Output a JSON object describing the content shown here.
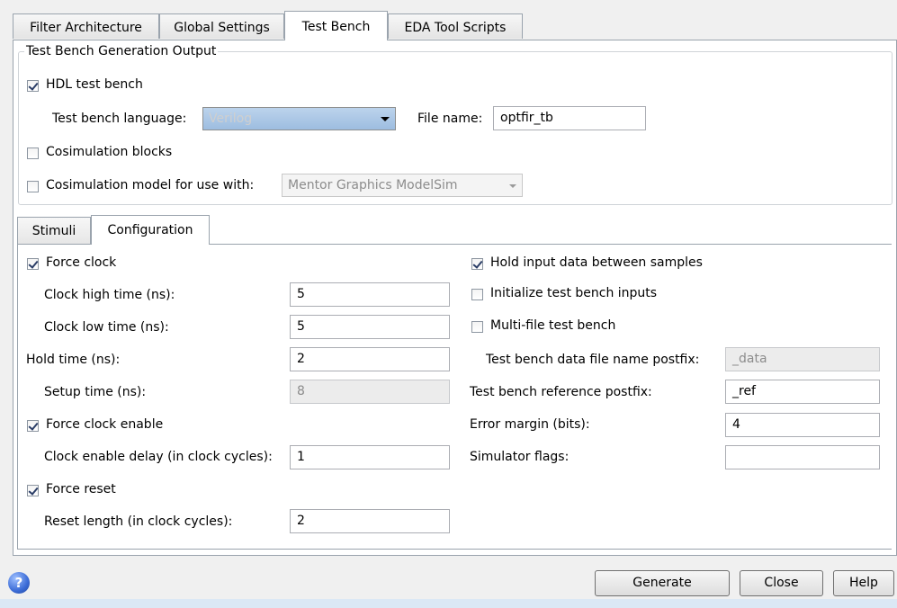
{
  "tabs": [
    "Filter Architecture",
    "Global Settings",
    "Test Bench",
    "EDA Tool Scripts"
  ],
  "output_group": {
    "title": "Test Bench Generation Output",
    "hdl_test_bench": {
      "label": "HDL test bench",
      "checked": true
    },
    "language_label": "Test bench language:",
    "language_value": "Verilog",
    "file_name_label": "File name:",
    "file_name_value": "optfir_tb",
    "cosim_blocks": {
      "label": "Cosimulation blocks",
      "checked": false
    },
    "cosim_model": {
      "label": "Cosimulation model for use with:",
      "checked": false
    },
    "cosim_tool_value": "Mentor Graphics ModelSim"
  },
  "inner_tabs": [
    "Stimuli",
    "Configuration"
  ],
  "config": {
    "force_clock": {
      "label": "Force clock",
      "checked": true
    },
    "clock_high_label": "Clock high time (ns):",
    "clock_high_value": "5",
    "clock_low_label": "Clock low time (ns):",
    "clock_low_value": "5",
    "hold_time_label": "Hold time (ns):",
    "hold_time_value": "2",
    "setup_time_label": "Setup time (ns):",
    "setup_time_value": "8",
    "force_clock_enable": {
      "label": "Force clock enable",
      "checked": true
    },
    "clock_enable_delay_label": "Clock enable delay (in clock cycles):",
    "clock_enable_delay_value": "1",
    "force_reset": {
      "label": "Force reset",
      "checked": true
    },
    "reset_length_label": "Reset length (in clock cycles):",
    "reset_length_value": "2",
    "hold_input": {
      "label": "Hold input data between samples",
      "checked": true
    },
    "init_inputs": {
      "label": "Initialize test bench inputs",
      "checked": false
    },
    "multi_file": {
      "label": "Multi-file test bench",
      "checked": false
    },
    "data_postfix_label": "Test bench data file name postfix:",
    "data_postfix_value": "_data",
    "ref_postfix_label": "Test bench reference postfix:",
    "ref_postfix_value": "_ref",
    "error_margin_label": "Error margin (bits):",
    "error_margin_value": "4",
    "simulator_flags_label": "Simulator flags:",
    "simulator_flags_value": ""
  },
  "buttons": {
    "generate": "Generate",
    "close": "Close",
    "help": "Help"
  },
  "icons": {
    "help": "help-circle-icon"
  },
  "colors": {
    "bottom_strip": "#dbe8f5",
    "help_icon": "#3b6bd6"
  }
}
